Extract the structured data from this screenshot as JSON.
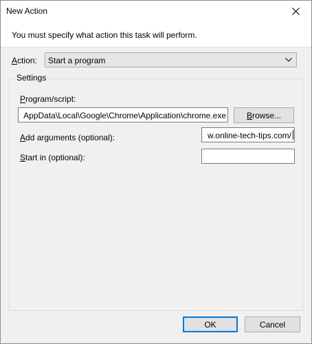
{
  "window": {
    "title": "New Action"
  },
  "instruction": "You must specify what action this task will perform.",
  "action": {
    "label_u": "A",
    "label_rest": "ction:",
    "value": "Start a program"
  },
  "settings": {
    "title": "Settings",
    "program": {
      "label_u": "P",
      "label_rest": "rogram/script:",
      "value": "AppData\\Local\\Google\\Chrome\\Application\\chrome.exe",
      "browse_u": "B",
      "browse_rest": "rowse..."
    },
    "arguments": {
      "label_u": "A",
      "label_rest": "dd arguments (optional):",
      "value": "w.online-tech-tips.com/"
    },
    "start_in": {
      "label_u": "S",
      "label_rest": "tart in (optional):",
      "value": ""
    }
  },
  "buttons": {
    "ok": "OK",
    "cancel": "Cancel"
  },
  "icons": {
    "close": "close-icon",
    "dropdown": "chevron-down-icon"
  },
  "colors": {
    "accent": "#0078d7",
    "title_bg": "#ffffff",
    "dialog_bg": "#f0f0f0"
  }
}
